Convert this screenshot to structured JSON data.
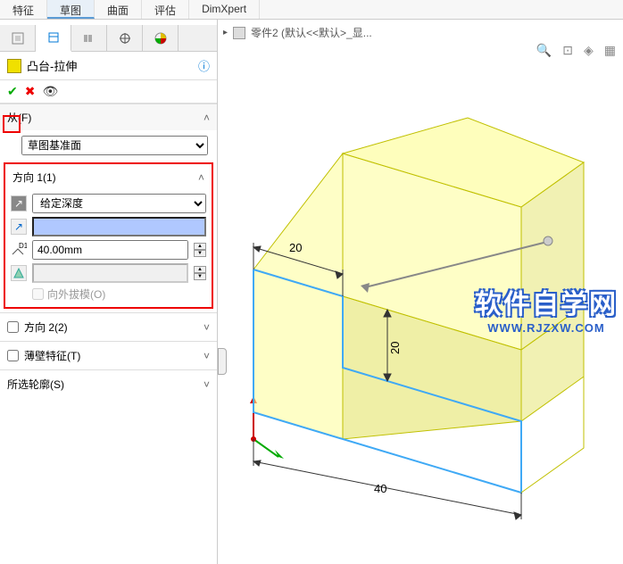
{
  "ribbon": {
    "tabs": [
      "特征",
      "草图",
      "曲面",
      "评估",
      "DimXpert"
    ]
  },
  "breadcrumb": {
    "part": "零件2 (默认<<默认>_显..."
  },
  "feature": {
    "title": "凸台-拉伸"
  },
  "from": {
    "label": "从(F)",
    "option": "草图基准面"
  },
  "dir1": {
    "label": "方向 1(1)",
    "end_condition": "给定深度",
    "depth": "40.00mm",
    "draft_outward": "向外拔模(O)"
  },
  "dir2": {
    "label": "方向 2(2)"
  },
  "thin": {
    "label": "薄壁特征(T)"
  },
  "contours": {
    "label": "所选轮廓(S)"
  },
  "dims": {
    "top": "20",
    "right": "20",
    "bottom": "40"
  },
  "watermark": {
    "cn": "软件自学网",
    "en": "WWW.RJZXW.COM"
  }
}
